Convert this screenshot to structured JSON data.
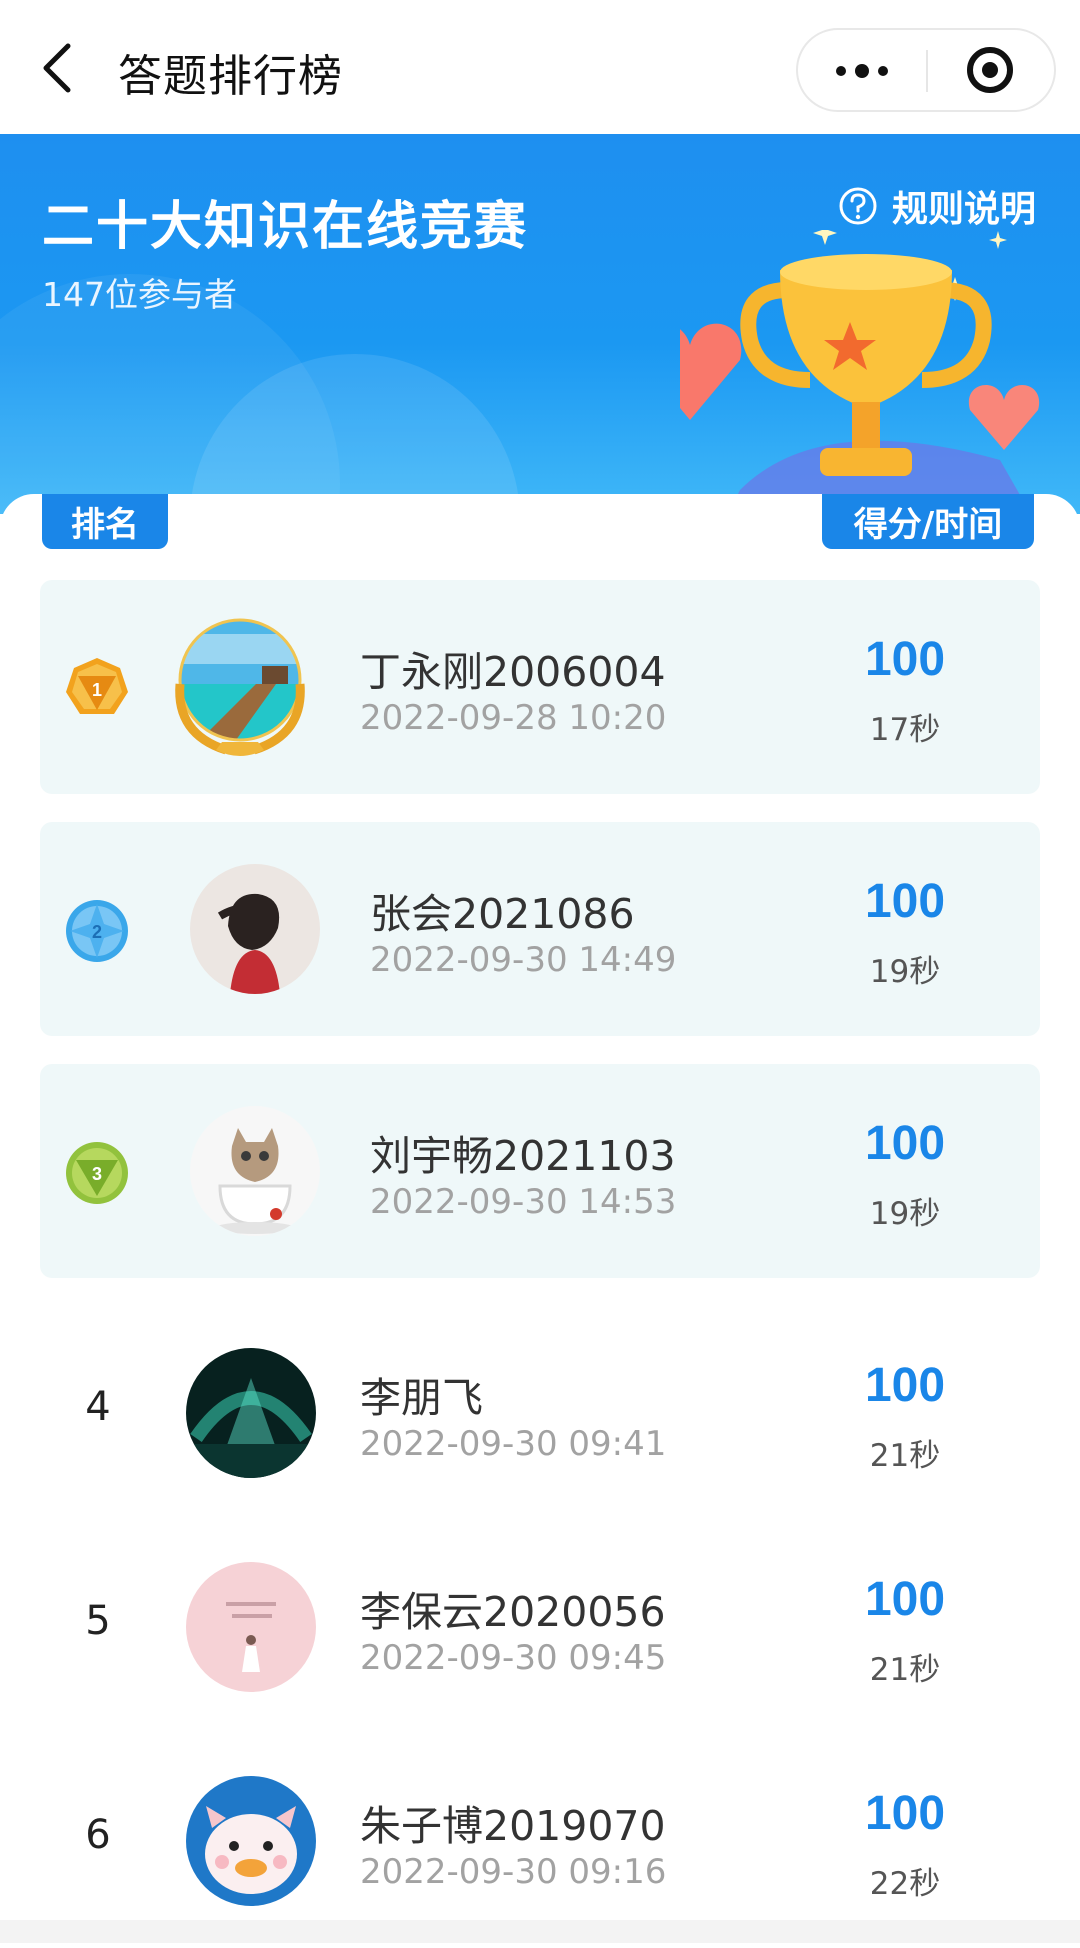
{
  "nav": {
    "title": "答题排行榜"
  },
  "banner": {
    "title": "二十大知识在线竞赛",
    "participants": "147位参与者",
    "rules_label": "规则说明"
  },
  "header": {
    "rank_label": "排名",
    "score_label": "得分/时间"
  },
  "colors": {
    "accent": "#1a86e8",
    "banner": "#1e8ff0",
    "row_bg": "#eff8f9"
  },
  "rows": [
    {
      "rank": "1",
      "badge": "gold-medal-icon",
      "name": "丁永刚2006004",
      "time": "2022-09-28 10:20",
      "score": "100",
      "seconds": "17秒"
    },
    {
      "rank": "2",
      "badge": "silver-medal-icon",
      "name": "张会2021086",
      "time": "2022-09-30 14:49",
      "score": "100",
      "seconds": "19秒"
    },
    {
      "rank": "3",
      "badge": "bronze-medal-icon",
      "name": "刘宇畅2021103",
      "time": "2022-09-30 14:53",
      "score": "100",
      "seconds": "19秒"
    },
    {
      "rank": "4",
      "name": "李朋飞",
      "time": "2022-09-30 09:41",
      "score": "100",
      "seconds": "21秒"
    },
    {
      "rank": "5",
      "name": "李保云2020056",
      "time": "2022-09-30 09:45",
      "score": "100",
      "seconds": "21秒"
    },
    {
      "rank": "6",
      "name": "朱子博2019070",
      "time": "2022-09-30 09:16",
      "score": "100",
      "seconds": "22秒"
    }
  ]
}
